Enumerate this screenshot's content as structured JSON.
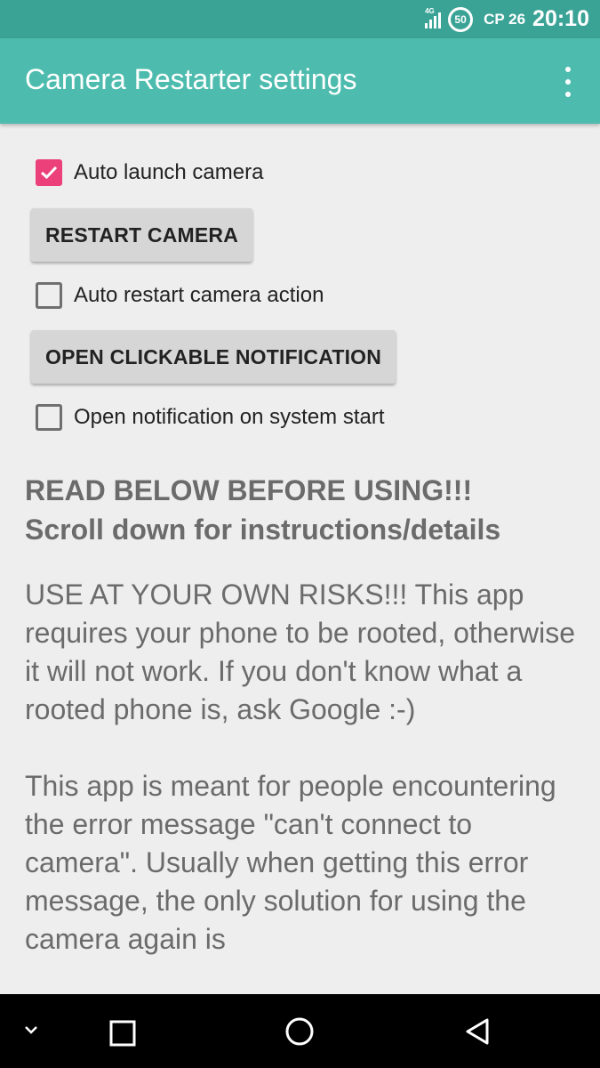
{
  "status_bar": {
    "network": "4G",
    "battery": "50",
    "date": "CP 26",
    "time": "20:10"
  },
  "app_bar": {
    "title": "Camera Restarter settings",
    "overflow_icon": "more-vert-icon"
  },
  "settings": {
    "auto_launch": {
      "label": "Auto launch camera",
      "checked": true
    },
    "restart_button": "RESTART CAMERA",
    "auto_restart": {
      "label": "Auto restart camera action",
      "checked": false
    },
    "notification_button": "OPEN CLICKABLE NOTIFICATION",
    "notify_on_start": {
      "label": "Open notification on system start",
      "checked": false
    }
  },
  "info": {
    "heading_line1": "READ BELOW BEFORE USING!!!",
    "heading_line2": "Scroll down for instructions/details",
    "paragraph1": "USE AT YOUR OWN RISKS!!! This app requires your phone to be rooted, otherwise it will not work. If you don't know what a rooted phone is, ask Google :-)",
    "paragraph2": "This app is meant for people encountering the error message \"can't connect to camera\". Usually when getting this error message, the only solution for using the camera again is"
  },
  "nav_bar": {
    "icons": [
      "chevron-down-icon",
      "recents-icon",
      "home-icon",
      "back-icon"
    ]
  },
  "colors": {
    "status_bar": "#3aa396",
    "app_bar": "#4dbcae",
    "accent": "#ec407a",
    "background": "#eeeeee"
  }
}
